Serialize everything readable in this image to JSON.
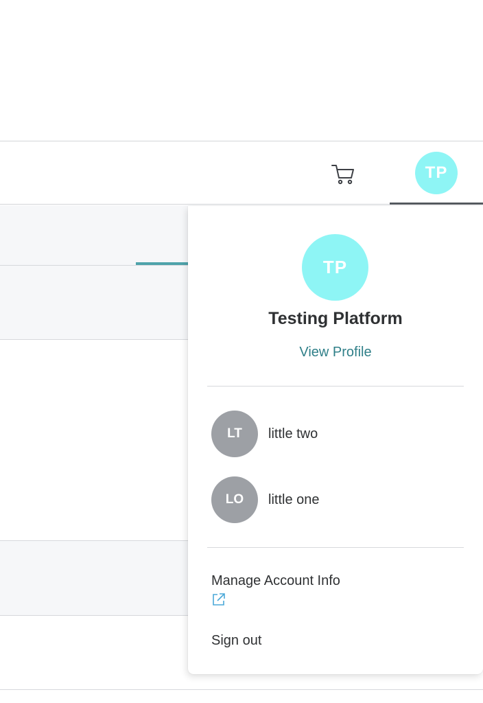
{
  "header": {
    "cart_icon": "shopping-cart-icon",
    "user_initials": "TP",
    "avatar_color": "#8ef5f5"
  },
  "dropdown": {
    "profile": {
      "initials": "TP",
      "name": "Testing Platform",
      "view_profile_label": "View Profile",
      "link_color": "#2f7f88"
    },
    "accounts": [
      {
        "initials": "LT",
        "name": "little two"
      },
      {
        "initials": "LO",
        "name": "little one"
      }
    ],
    "account_avatar_color": "#9da0a5",
    "manage_account_label": "Manage Account Info",
    "manage_account_icon": "external-link-icon",
    "sign_out_label": "Sign out"
  }
}
